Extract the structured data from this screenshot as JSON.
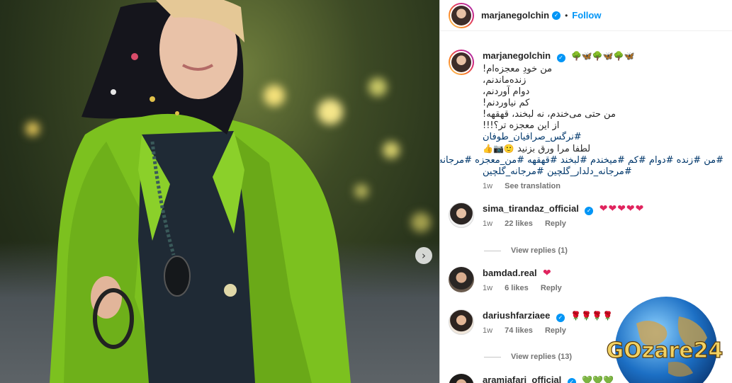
{
  "post": {
    "author": "marjanegolchin",
    "follow_label": "Follow",
    "separator": "•"
  },
  "caption": {
    "author": "marjanegolchin",
    "header_emoji": "🌳🦋🌳🦋🌳🦋",
    "lines": [
      "من خودِ معجزه‌ام!",
      "زنده‌ماندنم،",
      "دوام آوردنم،",
      "کم نیاوردنم!",
      "من حتی می‌خندم، نه لبخند، قهقهه!",
      "از این معجزه تر؟!!!"
    ],
    "hashtag_1": "#نرگس_صرافیان_طوفان",
    "prompt": "لطفا مرا ورق بزنید",
    "prompt_emoji": "🙂📷👍",
    "hashtags_2": "#من #زنده #دوام #کم #میخندم #لبخند #قهقهه #من_معجزه #مرجانه",
    "hashtags_3": "#مرجانه_دلدار_گلچین #مرجانه_گلچین",
    "time": "1w",
    "see_translation": "See translation"
  },
  "comments": [
    {
      "user": "sima_tirandaz_official",
      "verified": true,
      "text": "❤❤❤❤❤",
      "time": "1w",
      "likes": "22 likes",
      "reply": "Reply",
      "view_replies": "View replies (1)"
    },
    {
      "user": "bamdad.real",
      "verified": false,
      "text": "❤",
      "time": "1w",
      "likes": "6 likes",
      "reply": "Reply",
      "view_replies": ""
    },
    {
      "user": "dariushfarziaee",
      "verified": true,
      "text": "🌹🌹🌹🌹",
      "time": "1w",
      "likes": "74 likes",
      "reply": "Reply",
      "view_replies": "View replies (13)"
    },
    {
      "user": "aramjafari_official",
      "verified": true,
      "text": "💚💚💚",
      "time": "",
      "likes": "",
      "reply": "",
      "view_replies": ""
    }
  ],
  "watermark": {
    "text": "GOzare24"
  },
  "colors": {
    "accent": "#0095f6",
    "heart": "#e0245e",
    "jacket": "#7cc11f"
  },
  "icons": {
    "next": "chevron-right-icon",
    "verified": "verified-badge-icon"
  }
}
